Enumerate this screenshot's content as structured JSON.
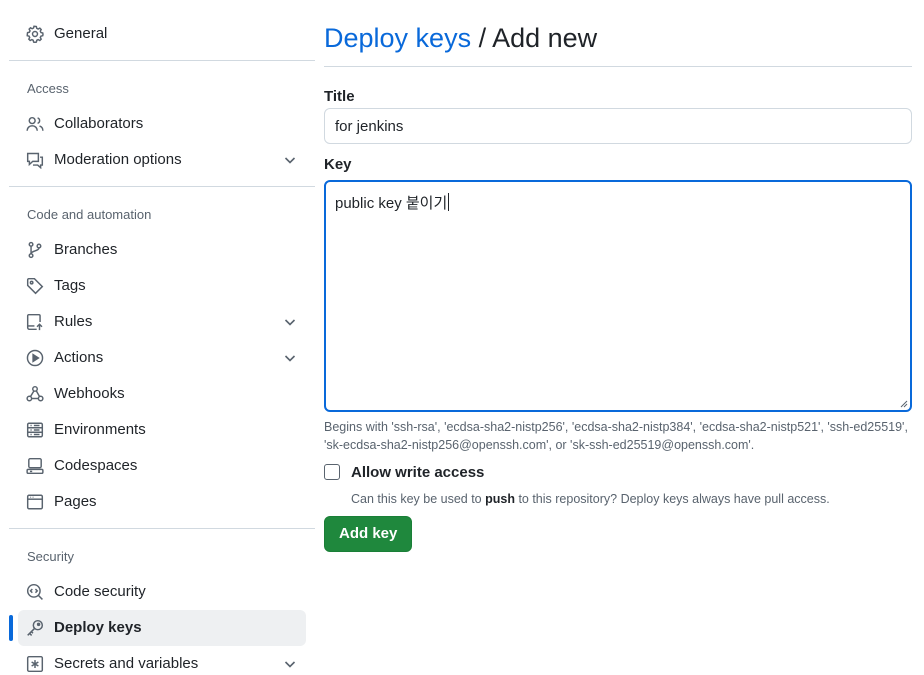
{
  "sidebar": {
    "general": {
      "label": "General",
      "icon": "gear-icon"
    },
    "sections": [
      {
        "heading": "Access",
        "items": [
          {
            "label": "Collaborators",
            "icon": "people-icon",
            "expandable": false
          },
          {
            "label": "Moderation options",
            "icon": "report-icon",
            "expandable": true
          }
        ]
      },
      {
        "heading": "Code and automation",
        "items": [
          {
            "label": "Branches",
            "icon": "git-branch-icon",
            "expandable": false
          },
          {
            "label": "Tags",
            "icon": "tag-icon",
            "expandable": false
          },
          {
            "label": "Rules",
            "icon": "repo-push-icon",
            "expandable": true
          },
          {
            "label": "Actions",
            "icon": "play-icon",
            "expandable": true
          },
          {
            "label": "Webhooks",
            "icon": "webhook-icon",
            "expandable": false
          },
          {
            "label": "Environments",
            "icon": "server-icon",
            "expandable": false
          },
          {
            "label": "Codespaces",
            "icon": "codespaces-icon",
            "expandable": false
          },
          {
            "label": "Pages",
            "icon": "browser-icon",
            "expandable": false
          }
        ]
      },
      {
        "heading": "Security",
        "items": [
          {
            "label": "Code security",
            "icon": "codescan-icon",
            "expandable": false
          },
          {
            "label": "Deploy keys",
            "icon": "key-icon",
            "expandable": false,
            "active": true
          },
          {
            "label": "Secrets and variables",
            "icon": "key-asterisk-icon",
            "expandable": true
          }
        ]
      }
    ]
  },
  "main": {
    "breadcrumb_link": "Deploy keys",
    "breadcrumb_separator": " / ",
    "breadcrumb_current": "Add new",
    "title_label": "Title",
    "title_value": "for jenkins",
    "key_label": "Key",
    "key_value": "public key 붙이기",
    "key_hint": "Begins with 'ssh-rsa', 'ecdsa-sha2-nistp256', 'ecdsa-sha2-nistp384', 'ecdsa-sha2-nistp521', 'ssh-ed25519', 'sk-ecdsa-sha2-nistp256@openssh.com', or 'sk-ssh-ed25519@openssh.com'.",
    "allow_write_label": "Allow write access",
    "allow_write_checked": false,
    "allow_write_desc_prefix": "Can this key be used to ",
    "allow_write_desc_bold": "push",
    "allow_write_desc_suffix": " to this repository? Deploy keys always have pull access.",
    "add_key_button": "Add key"
  },
  "colors": {
    "accent": "#0969da",
    "primary_button": "#1f883d",
    "muted_text": "#59636e",
    "active_nav_bg": "#eef0f2"
  }
}
